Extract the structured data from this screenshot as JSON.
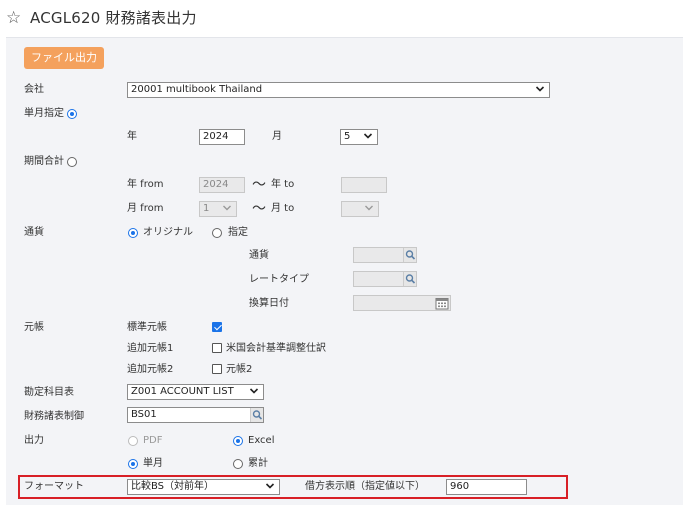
{
  "header": {
    "title": "ACGL620 財務諸表出力"
  },
  "toolbar": {
    "export_label": "ファイル出力"
  },
  "company": {
    "label": "会社",
    "value": "20001 multibook Thailand"
  },
  "single_month": {
    "label": "単月指定",
    "year_label": "年",
    "year": "2024",
    "month_label": "月",
    "month": "5"
  },
  "period": {
    "label": "期間合計",
    "year_from_label": "年 from",
    "year_from": "2024",
    "year_to_label": "年 to",
    "year_to": "",
    "month_from_label": "月 from",
    "month_from": "1",
    "month_to_label": "月 to",
    "month_to": "",
    "tilde": "〜"
  },
  "currency": {
    "label": "通貨",
    "option_original": "オリジナル",
    "option_specified": "指定",
    "currency_label": "通貨",
    "rate_type_label": "レートタイプ",
    "conversion_date_label": "換算日付"
  },
  "ledger": {
    "label": "元帳",
    "standard_label": "標準元帳",
    "additional1_label": "追加元帳1",
    "additional1_option": "米国会計基準調整仕訳",
    "additional2_label": "追加元帳2",
    "additional2_option": "元帳2"
  },
  "account_chart": {
    "label": "勘定科目表",
    "value": "Z001 ACCOUNT LIST"
  },
  "fs_control": {
    "label": "財務諸表制御",
    "value": "BS01"
  },
  "output": {
    "label": "出力",
    "pdf_label": "PDF",
    "excel_label": "Excel",
    "single_month_label": "単月",
    "cumulative_label": "累計"
  },
  "format": {
    "label": "フォーマット",
    "value": "比較BS（対前年）",
    "credit_order_label": "借方表示順（指定値以下）",
    "credit_order_value": "960"
  },
  "icons": {
    "star": "star-outline-icon",
    "search": "magnifier-icon",
    "calendar": "calendar-icon",
    "chevron": "chevron-down-icon"
  },
  "colors": {
    "accent": "#1a73e8",
    "export_button": "#f4a15d",
    "highlight": "#d81f26"
  }
}
